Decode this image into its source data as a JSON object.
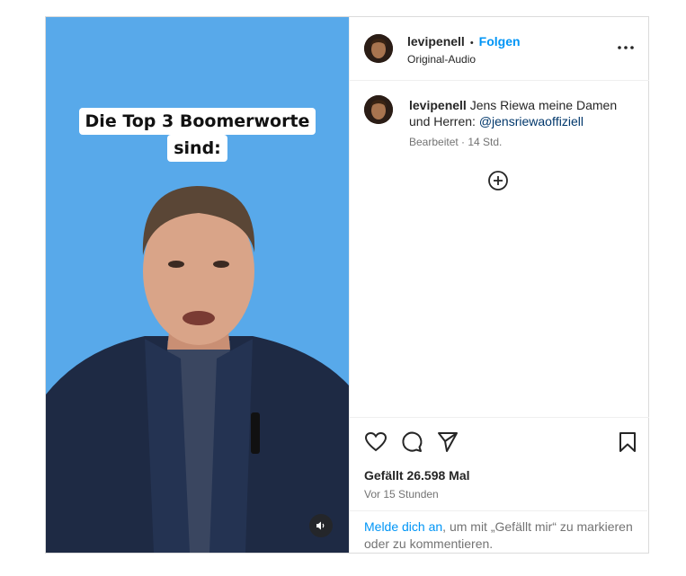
{
  "video": {
    "overlay_line1": "Die Top 3 Boomerworte",
    "overlay_line2": "sind:"
  },
  "header": {
    "username": "levipenell",
    "separator": "•",
    "follow_label": "Folgen",
    "audio": "Original-Audio"
  },
  "caption": {
    "username": "levipenell",
    "text": "Jens Riewa meine Damen und Herren:",
    "mention": "@jensriewaofﬁziell",
    "meta": "Bearbeitet · 14 Std."
  },
  "stats": {
    "likes": "Gefällt 26.598 Mal",
    "time": "Vor 15 Stunden"
  },
  "login_prompt": {
    "link": "Melde dich an",
    "text": ", um mit „Gefällt mir“ zu markieren oder zu kommentieren."
  },
  "colors": {
    "accent": "#0095f6",
    "video_bg": "#58a9ea",
    "link": "#00376b"
  },
  "icons": [
    "more-options-icon",
    "add-comment-icon",
    "heart-icon",
    "comment-icon",
    "share-icon",
    "bookmark-icon",
    "audio-icon"
  ]
}
